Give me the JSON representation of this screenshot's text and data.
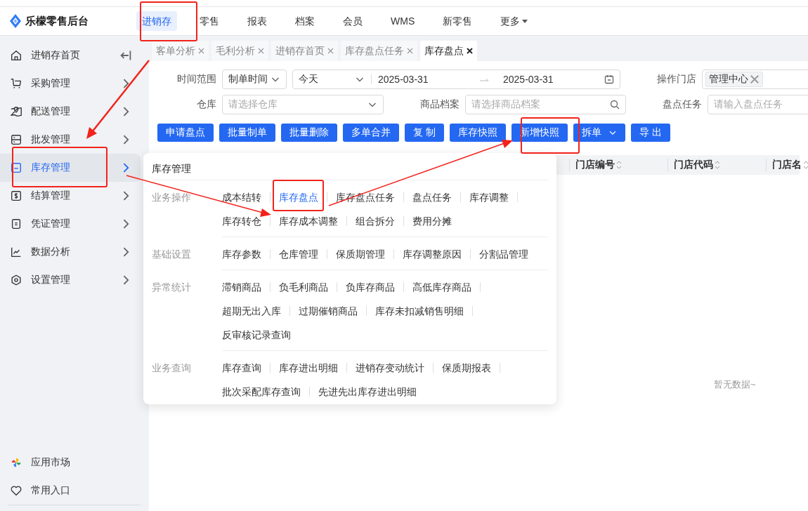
{
  "app": {
    "name": "乐檬零售后台"
  },
  "top_nav": [
    {
      "label": "进销存",
      "selected": true,
      "dropdown": false
    },
    {
      "label": "零售",
      "selected": false,
      "dropdown": false
    },
    {
      "label": "报表",
      "selected": false,
      "dropdown": false
    },
    {
      "label": "档案",
      "selected": false,
      "dropdown": false
    },
    {
      "label": "会员",
      "selected": false,
      "dropdown": false
    },
    {
      "label": "WMS",
      "selected": false,
      "dropdown": false
    },
    {
      "label": "新零售",
      "selected": false,
      "dropdown": false
    },
    {
      "label": "更多",
      "selected": false,
      "dropdown": true
    }
  ],
  "sidebar": {
    "items": [
      {
        "label": "进销存首页",
        "kind": "home",
        "selected": false
      },
      {
        "label": "采购管理",
        "kind": "menu",
        "selected": false
      },
      {
        "label": "配送管理",
        "kind": "menu",
        "selected": false
      },
      {
        "label": "批发管理",
        "kind": "menu",
        "selected": false
      },
      {
        "label": "库存管理",
        "kind": "menu",
        "selected": true
      },
      {
        "label": "结算管理",
        "kind": "menu",
        "selected": false
      },
      {
        "label": "凭证管理",
        "kind": "menu",
        "selected": false
      },
      {
        "label": "数据分析",
        "kind": "menu",
        "selected": false
      },
      {
        "label": "设置管理",
        "kind": "menu",
        "selected": false
      }
    ],
    "bottom_items": [
      {
        "label": "应用市场"
      },
      {
        "label": "常用入口"
      }
    ]
  },
  "tabs": [
    {
      "label": "客单分析",
      "selected": false
    },
    {
      "label": "毛利分析",
      "selected": false
    },
    {
      "label": "进销存首页",
      "selected": false
    },
    {
      "label": "库存盘点任务",
      "selected": false
    },
    {
      "label": "库存盘点",
      "selected": true
    }
  ],
  "filters": {
    "time_range": {
      "label": "时间范围",
      "type": "制单时间",
      "period": "今天",
      "start": "2025-03-31",
      "end": "2025-03-31"
    },
    "store": {
      "label": "操作门店",
      "tag": "管理中心"
    },
    "warehouse": {
      "label": "仓库",
      "placeholder": "请选择仓库"
    },
    "product": {
      "label": "商品档案",
      "placeholder": "请选择商品档案"
    },
    "task": {
      "label": "盘点任务",
      "placeholder": "请输入盘点任务"
    }
  },
  "buttons": [
    {
      "label": "申请盘点",
      "dropdown": false
    },
    {
      "label": "批量制单",
      "dropdown": false
    },
    {
      "label": "批量删除",
      "dropdown": false
    },
    {
      "label": "多单合并",
      "dropdown": false
    },
    {
      "label": "复 制",
      "dropdown": false
    },
    {
      "label": "库存快照",
      "dropdown": false
    },
    {
      "label": "新增快照",
      "dropdown": false
    },
    {
      "label": "拆单",
      "dropdown": true
    },
    {
      "label": "导 出",
      "dropdown": false
    }
  ],
  "table": {
    "columns": [
      "门店编号",
      "门店代码",
      "门店名"
    ],
    "empty_text": "暂无数据~"
  },
  "flyout": {
    "title": "库存管理",
    "sections": [
      {
        "title": "业务操作",
        "items": [
          {
            "label": "成本结转",
            "selected": false
          },
          {
            "label": "库存盘点",
            "selected": true
          },
          {
            "label": "库存盘点任务",
            "selected": false
          },
          {
            "label": "盘点任务",
            "selected": false
          },
          {
            "label": "库存调整",
            "selected": false
          },
          {
            "label": "库存转仓",
            "selected": false
          },
          {
            "label": "库存成本调整",
            "selected": false
          },
          {
            "label": "组合拆分",
            "selected": false
          },
          {
            "label": "费用分摊",
            "selected": false
          }
        ]
      },
      {
        "title": "基础设置",
        "items": [
          {
            "label": "库存参数",
            "selected": false
          },
          {
            "label": "仓库管理",
            "selected": false
          },
          {
            "label": "保质期管理",
            "selected": false
          },
          {
            "label": "库存调整原因",
            "selected": false
          },
          {
            "label": "分割品管理",
            "selected": false
          }
        ]
      },
      {
        "title": "异常统计",
        "items": [
          {
            "label": "滞销商品",
            "selected": false
          },
          {
            "label": "负毛利商品",
            "selected": false
          },
          {
            "label": "负库存商品",
            "selected": false
          },
          {
            "label": "高低库存商品",
            "selected": false
          },
          {
            "label": "超期无出入库",
            "selected": false
          },
          {
            "label": "过期催销商品",
            "selected": false
          },
          {
            "label": "库存未扣减销售明细",
            "selected": false
          },
          {
            "label": "反审核记录查询",
            "selected": false
          }
        ]
      },
      {
        "title": "业务查询",
        "items": [
          {
            "label": "库存查询",
            "selected": false
          },
          {
            "label": "库存进出明细",
            "selected": false
          },
          {
            "label": "进销存变动统计",
            "selected": false
          },
          {
            "label": "保质期报表",
            "selected": false
          },
          {
            "label": "批次采配库存查询",
            "selected": false
          },
          {
            "label": "先进先出库存进出明细",
            "selected": false
          }
        ]
      }
    ]
  }
}
